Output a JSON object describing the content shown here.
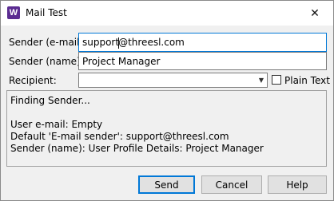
{
  "window": {
    "title": "Mail Test",
    "app_icon_letter": "W",
    "close_glyph": "✕"
  },
  "form": {
    "sender_email_label": "Sender (e-mail):",
    "sender_email_value_before_caret": "support",
    "sender_email_value_after_caret": "@threesl.com",
    "sender_name_label": "Sender (name):",
    "sender_name_value": "Project Manager",
    "recipient_label": "Recipient:",
    "recipient_value": "",
    "plain_text_label": "Plain Text",
    "plain_text_checked": false
  },
  "log": {
    "lines": [
      "Finding Sender...",
      "",
      "User e-mail: Empty",
      "Default 'E-mail sender': support@threesl.com",
      "Sender (name): User Profile Details: Project Manager"
    ]
  },
  "buttons": {
    "send": "Send",
    "cancel": "Cancel",
    "help": "Help"
  },
  "icons": {
    "app": "app-icon",
    "close": "close-icon",
    "dropdown": "chevron-down-icon"
  },
  "colors": {
    "app_icon_bg": "#5b2c91",
    "focus_accent": "#0078d7"
  }
}
